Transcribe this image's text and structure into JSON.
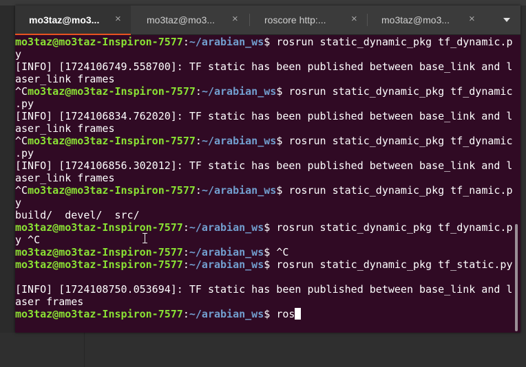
{
  "tabs": [
    {
      "label": "mo3taz@mo3...",
      "active": true
    },
    {
      "label": "mo3taz@mo3..."
    },
    {
      "label": "roscore http:..."
    },
    {
      "label": "mo3taz@mo3..."
    }
  ],
  "tab_close_glyph": "×",
  "prompt": {
    "user": "mo3taz@mo3taz-Inspiron-7577",
    "colon": ":",
    "path": "~/arabian_ws",
    "dollar": "$ "
  },
  "output": [
    "[INFO] [1724106749.558700]: TF static has been published between base_link and l",
    "aser_link frames",
    "[INFO] [1724106834.762020]: TF static has been published between base_link and l",
    "aser_link frames",
    "[INFO] [1724106856.302012]: TF static has been published between base_link and l",
    "aser_link frames",
    "build/  devel/  src/",
    "[INFO] [1724108750.053694]: TF static has been published between base_link and l",
    "aser frames"
  ],
  "commands": [
    {
      "prefix": "",
      "cmd": "rosrun static_dynamic_pkg tf_dynamic.p",
      "wrap": "y"
    },
    {
      "prefix": "^C",
      "cmd": "rosrun static_dynamic_pkg tf_dynamic",
      "wrap": ".py"
    },
    {
      "prefix": "^C",
      "cmd": "rosrun static_dynamic_pkg tf_dynamic",
      "wrap": ".py"
    },
    {
      "prefix": "^C",
      "cmd": "rosrun static_dynamic_pkg tf_namic.p",
      "wrap": "y"
    },
    {
      "prefix": "",
      "cmd": "rosrun static_dynamic_pkg tf_dynamic.p",
      "wrap": "y ^C"
    },
    {
      "prefix": "",
      "cmd": "^C"
    },
    {
      "prefix": "",
      "cmd": "rosrun static_dynamic_pkg tf_static.py"
    },
    {
      "prefix": "",
      "cmd": "ros"
    }
  ]
}
